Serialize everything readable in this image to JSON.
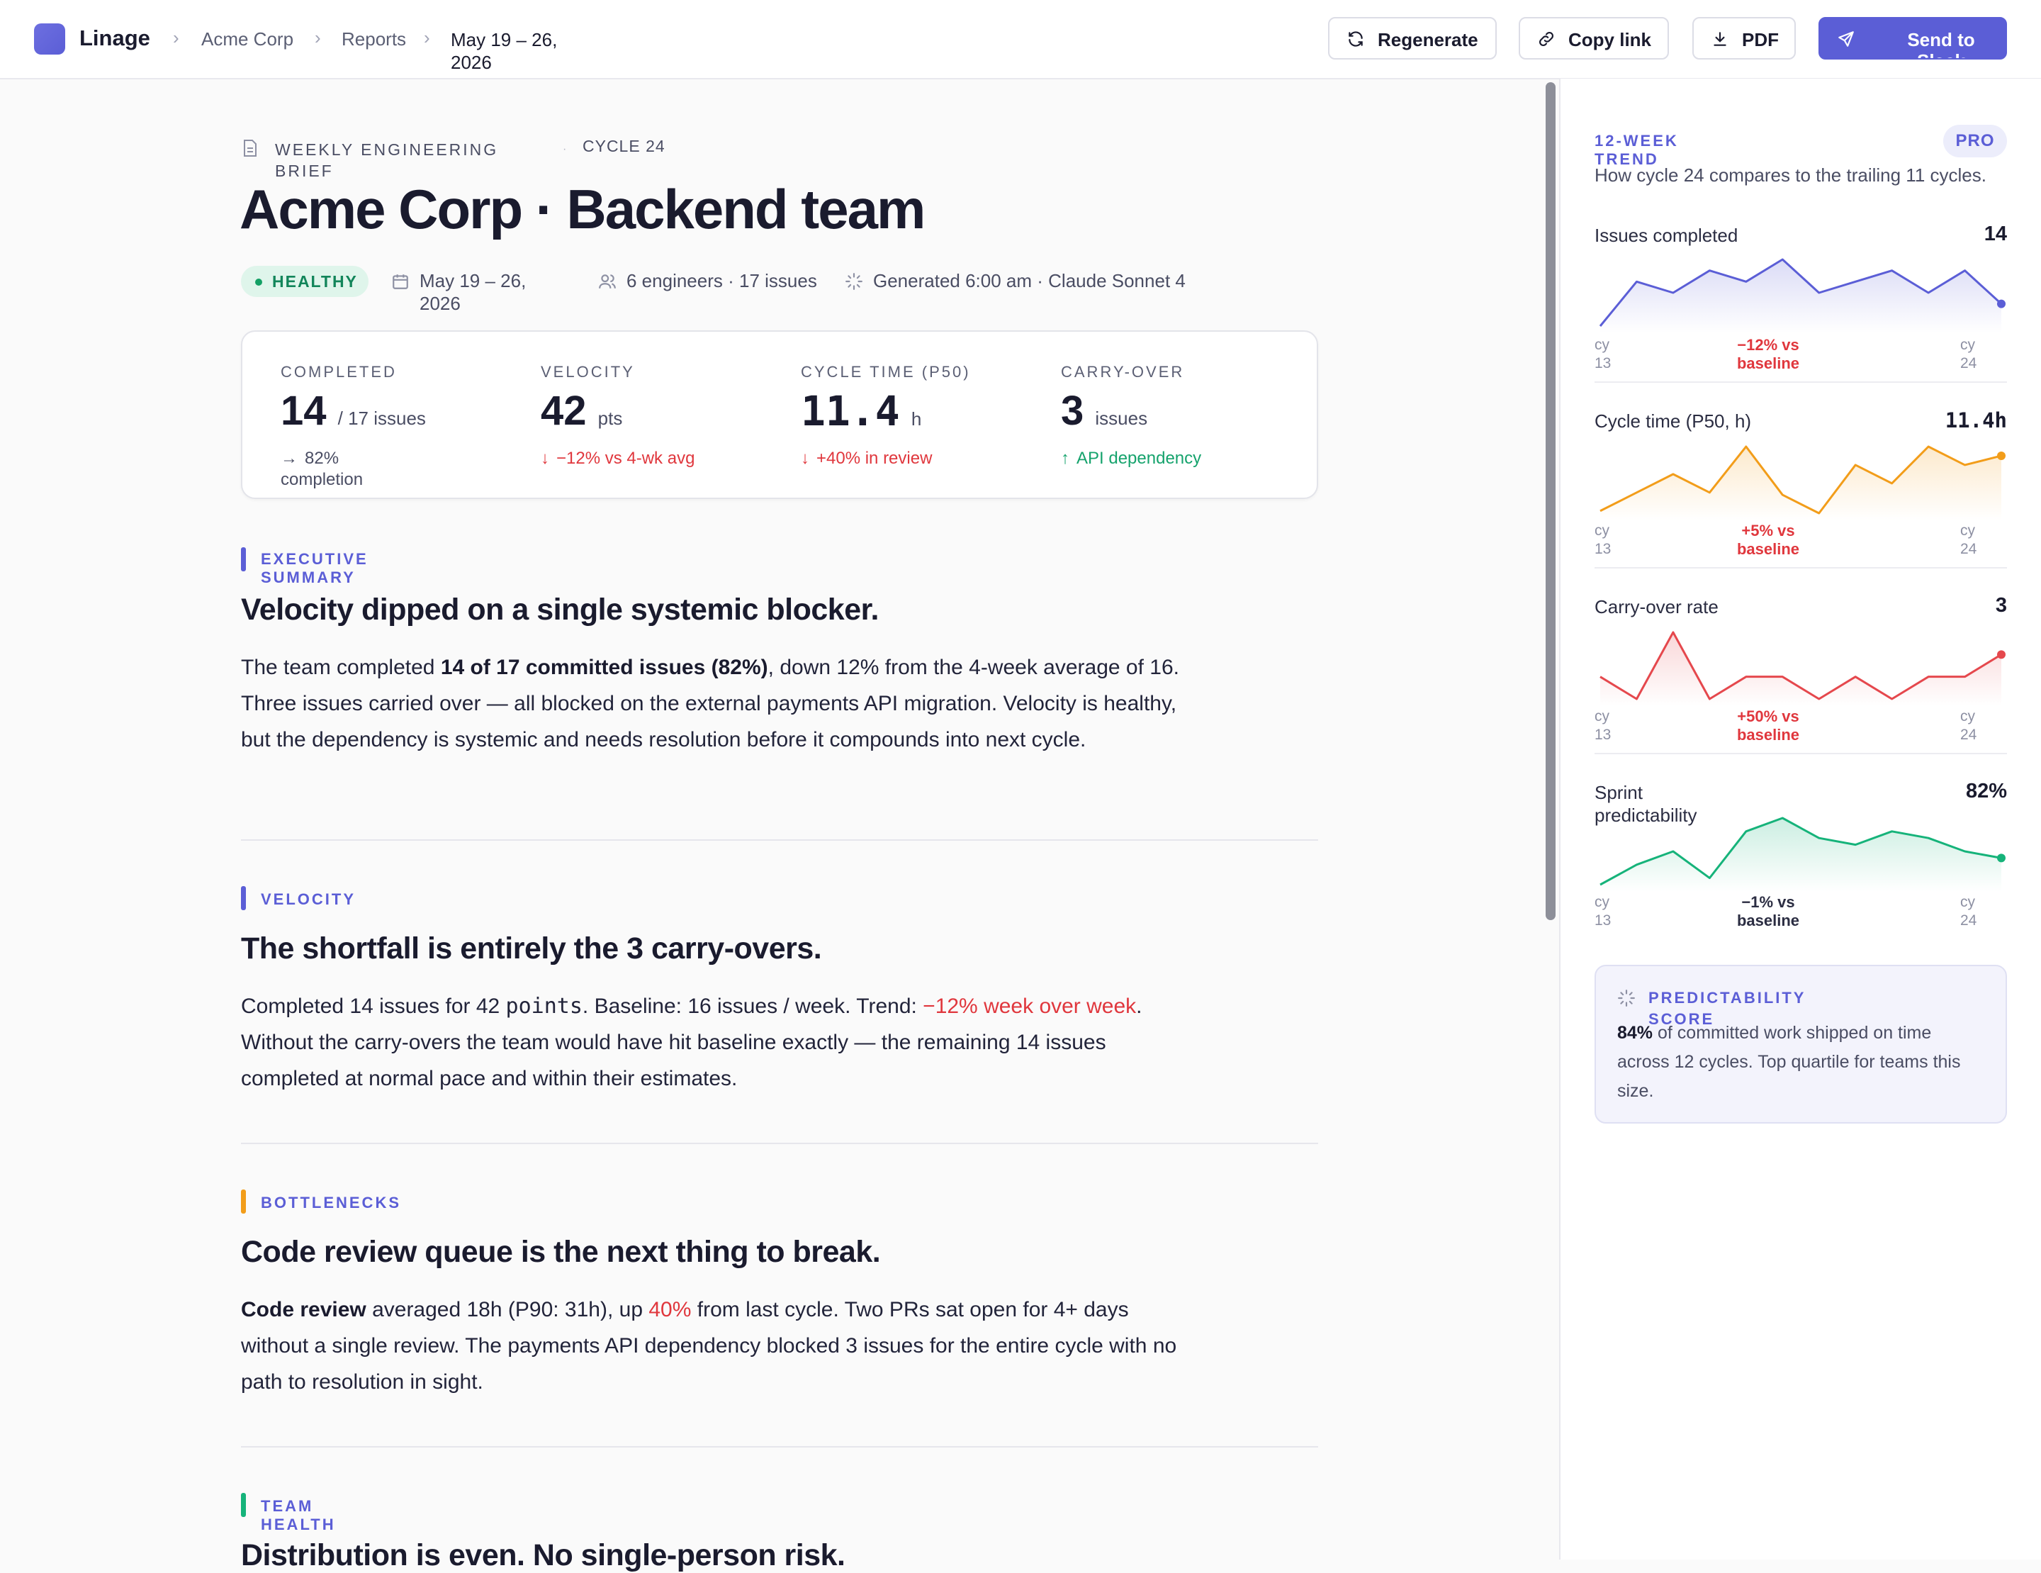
{
  "app": {
    "name": "Linage"
  },
  "breadcrumb": {
    "org": "Acme Corp",
    "section": "Reports",
    "current": "May 19 – 26, 2026"
  },
  "toolbar": {
    "regenerate": "Regenerate",
    "copy_link": "Copy link",
    "pdf": "PDF",
    "send": "Send to Slack"
  },
  "brief": {
    "kicker": "WEEKLY ENGINEERING BRIEF",
    "cycle": "CYCLE 24",
    "title": "Acme Corp · Backend team",
    "status": "HEALTHY",
    "date_range": "May 19 – 26, 2026",
    "team_meta": "6 engineers · 17 issues",
    "generated": "Generated 6:00 am · Claude Sonnet 4"
  },
  "kpis": [
    {
      "label": "COMPLETED",
      "value": "14",
      "unit": "/ 17 issues",
      "delta": "82% completion",
      "arrow": "→",
      "tone": "neutral"
    },
    {
      "label": "VELOCITY",
      "value": "42",
      "unit": "pts",
      "delta": "−12% vs 4-wk avg",
      "arrow": "↓",
      "tone": "negative"
    },
    {
      "label": "CYCLE TIME (P50)",
      "value": "11.4",
      "unit": "h",
      "delta": "+40% in review",
      "arrow": "↓",
      "tone": "negative"
    },
    {
      "label": "CARRY-OVER",
      "value": "3",
      "unit": "issues",
      "delta": "API dependency",
      "arrow": "↑",
      "tone": "positive"
    }
  ],
  "sections": {
    "summary": {
      "label": "EXECUTIVE SUMMARY",
      "heading": "Velocity dipped on a single systemic blocker.",
      "p1": "The team completed ",
      "b1": "14 of 17 committed issues (82%)",
      "p2": ", down 12% from the 4-week average of 16. Three issues carried over — all blocked on the external payments API migration. Velocity is healthy, but the dependency is systemic and needs resolution before it compounds into next cycle."
    },
    "velocity": {
      "label": "VELOCITY",
      "heading": "The shortfall is entirely the 3 carry-overs.",
      "p1": "Completed 14 issues for 42 ",
      "code": "points",
      "p2": ". Baseline: 16 issues / week. Trend: ",
      "red": "−12% week over week",
      "p3": ". Without the carry-overs the team would have hit baseline exactly — the remaining 14 issues completed at normal pace and within their estimates."
    },
    "bottlenecks": {
      "label": "BOTTLENECKS",
      "heading": "Code review queue is the next thing to break.",
      "b1": "Code review",
      "p1": " averaged 18h (P90: 31h), up ",
      "red": "40%",
      "p2": " from last cycle. Two PRs sat open for 4+ days without a single review. The payments API dependency blocked 3 issues for the entire cycle with no path to resolution in sight."
    },
    "team": {
      "label": "TEAM HEALTH",
      "heading": "Distribution is even. No single-person risk."
    }
  },
  "trend": {
    "kicker": "12-WEEK TREND",
    "badge": "PRO",
    "subtitle": "How cycle 24 compares to the trailing 11 cycles.",
    "axis_start": "cy 13",
    "axis_end": "cy 24",
    "panels": [
      {
        "title": "Issues completed",
        "value": "14",
        "delta": "−12% vs baseline",
        "color": "#5b5ed6",
        "delta_color": "#e0373d",
        "values": [
          10,
          14,
          13,
          15,
          14,
          16,
          13,
          14,
          15,
          13,
          15,
          12
        ]
      },
      {
        "title": "Cycle time (P50, h)",
        "value": "11.4h",
        "delta": "+5% vs baseline",
        "color": "#f29d1a",
        "delta_color": "#e0373d",
        "values": [
          9.0,
          9.8,
          10.6,
          9.8,
          11.8,
          9.7,
          8.9,
          11.0,
          10.2,
          11.8,
          11.0,
          11.4
        ]
      },
      {
        "title": "Carry-over rate",
        "value": "3",
        "delta": "+50% vs baseline",
        "color": "#e5484d",
        "delta_color": "#e0373d",
        "values": [
          2,
          1,
          4,
          1,
          2,
          2,
          1,
          2,
          1,
          2,
          2,
          3
        ]
      },
      {
        "title": "Sprint predictability",
        "value": "82%",
        "delta": "−1% vs baseline",
        "color": "#16b37a",
        "delta_color": "#2b2d42",
        "values": [
          76,
          79,
          81,
          77,
          84,
          86,
          83,
          82,
          84,
          83,
          81,
          80
        ]
      }
    ]
  },
  "predictability": {
    "kicker": "PREDICTABILITY SCORE",
    "value": "84%",
    "text": " of committed work shipped on time across 12 cycles. Top quartile for teams this size."
  }
}
